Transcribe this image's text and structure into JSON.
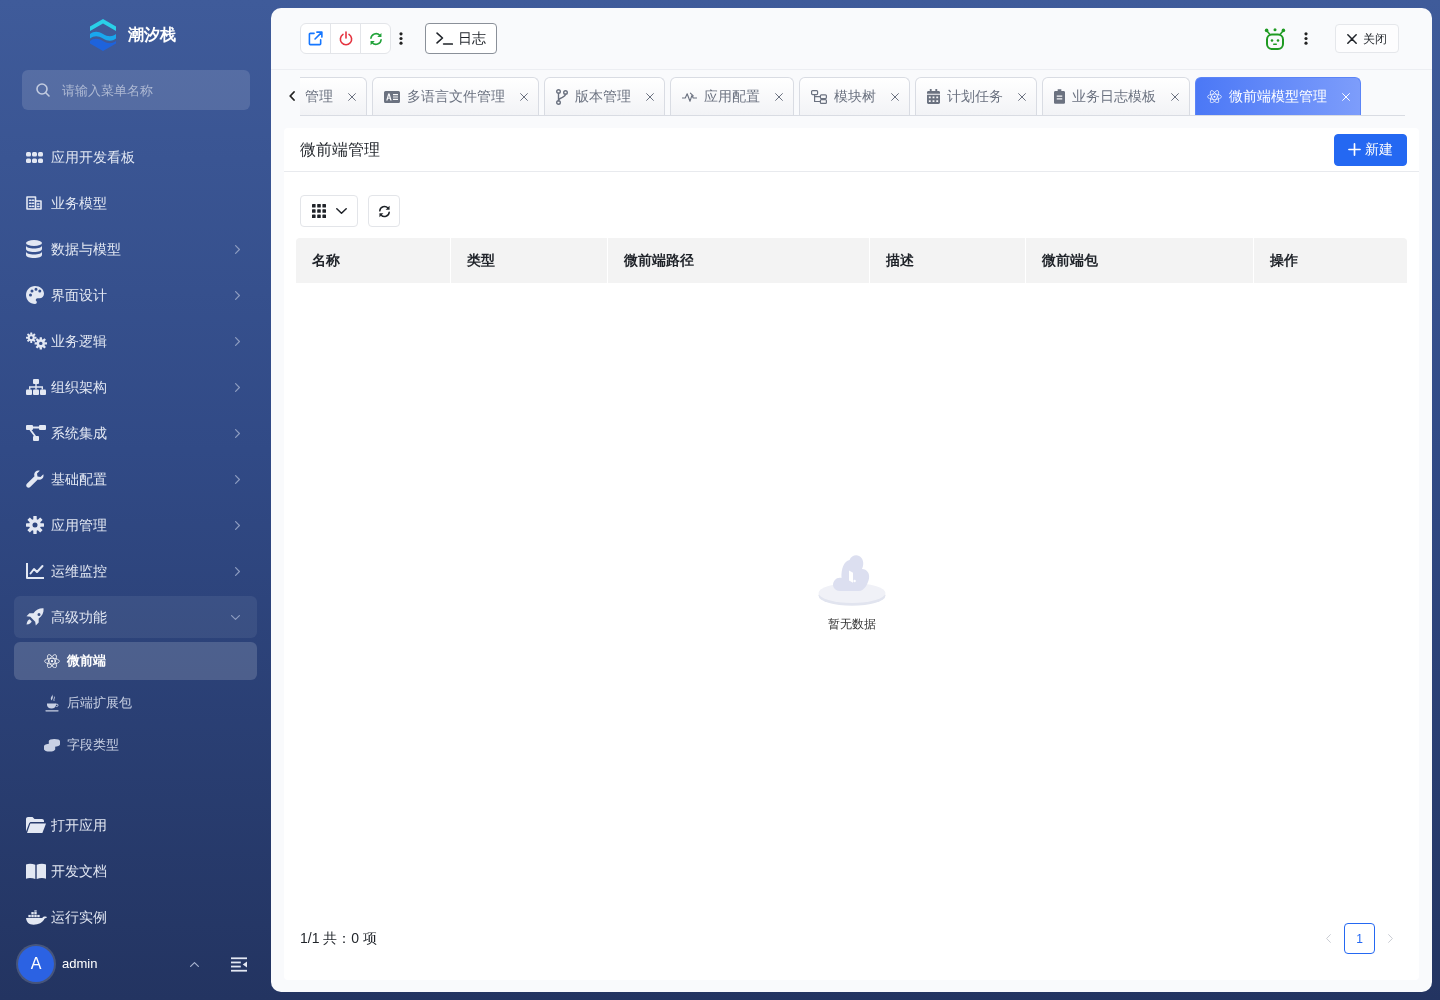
{
  "sidebar": {
    "logo_text": "潮汐栈",
    "search": {
      "placeholder": "请输入菜单名称"
    },
    "menu": [
      {
        "label": "应用开发看板",
        "kind": "leaf",
        "selected": false
      },
      {
        "label": "业务模型",
        "kind": "leaf",
        "selected": false
      },
      {
        "label": "数据与模型",
        "kind": "group",
        "expanded": false,
        "selected": false
      },
      {
        "label": "界面设计",
        "kind": "group",
        "expanded": false,
        "selected": false
      },
      {
        "label": "业务逻辑",
        "kind": "group",
        "expanded": false,
        "selected": false
      },
      {
        "label": "组织架构",
        "kind": "group",
        "expanded": false,
        "selected": false
      },
      {
        "label": "系统集成",
        "kind": "group",
        "expanded": false,
        "selected": false
      },
      {
        "label": "基础配置",
        "kind": "group",
        "expanded": false,
        "selected": false
      },
      {
        "label": "应用管理",
        "kind": "group",
        "expanded": false,
        "selected": false
      },
      {
        "label": "运维监控",
        "kind": "group",
        "expanded": false,
        "selected": false
      },
      {
        "label": "高级功能",
        "kind": "group",
        "expanded": true,
        "selected": false,
        "children": [
          {
            "label": "微前端",
            "selected": true
          },
          {
            "label": "后端扩展包",
            "selected": false
          },
          {
            "label": "字段类型",
            "selected": false
          }
        ]
      }
    ],
    "bottom_menu": [
      {
        "label": "打开应用",
        "selected": false
      },
      {
        "label": "开发文档",
        "selected": false
      },
      {
        "label": "运行实例",
        "selected": false
      }
    ],
    "user": {
      "initial": "A",
      "name": "admin"
    }
  },
  "toolbar": {
    "log_button": "日志",
    "close_button": "关闭"
  },
  "tabs": [
    {
      "label": "管理",
      "selected": false
    },
    {
      "label": "多语言文件管理",
      "selected": false
    },
    {
      "label": "版本管理",
      "selected": false
    },
    {
      "label": "应用配置",
      "selected": false
    },
    {
      "label": "模块树",
      "selected": false
    },
    {
      "label": "计划任务",
      "selected": false
    },
    {
      "label": "业务日志模板",
      "selected": false
    },
    {
      "label": "微前端模型管理",
      "selected": true
    }
  ],
  "panel": {
    "title": "微前端管理",
    "new_button": "新建",
    "table": {
      "columns": [
        "名称",
        "类型",
        "微前端路径",
        "描述",
        "微前端包",
        "操作"
      ],
      "empty_text": "暂无数据"
    },
    "pagination": {
      "summary": "1/1 共：0 项",
      "pages": [
        {
          "label": "1",
          "selected": true
        }
      ],
      "prev_disabled": true,
      "next_disabled": true
    }
  }
}
